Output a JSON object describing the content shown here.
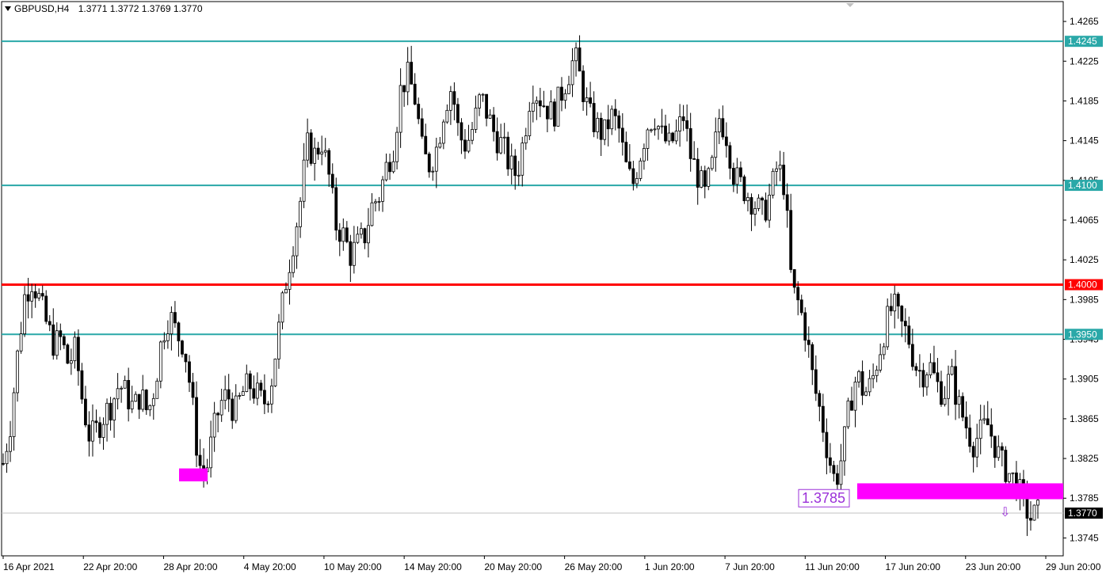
{
  "header": {
    "symbol": "GBPUSD,H4",
    "open": "1.3771",
    "high": "1.3772",
    "low": "1.3769",
    "close": "1.3770"
  },
  "chart_data": {
    "type": "candlestick",
    "instrument": "GBPUSD",
    "timeframe": "H4",
    "ylim": [
      1.3727,
      1.4285
    ],
    "y_ticks": [
      "1.4265",
      "1.4225",
      "1.4185",
      "1.4145",
      "1.4105",
      "1.4065",
      "1.4025",
      "1.3985",
      "1.3945",
      "1.3905",
      "1.3865",
      "1.3825",
      "1.3785",
      "1.3745"
    ],
    "x_ticks": [
      "16 Apr 2021",
      "22 Apr 20:00",
      "28 Apr 20:00",
      "4 May 20:00",
      "10 May 20:00",
      "14 May 20:00",
      "20 May 20:00",
      "26 May 20:00",
      "1 Jun 20:00",
      "7 Jun 20:00",
      "11 Jun 20:00",
      "17 Jun 20:00",
      "23 Jun 20:00",
      "29 Jun 20:00"
    ],
    "levels": [
      {
        "price": 1.4245,
        "label": "1.4245",
        "color": "#2aa8a8"
      },
      {
        "price": 1.41,
        "label": "1.4100",
        "color": "#2aa8a8"
      },
      {
        "price": 1.4,
        "label": "1.4000",
        "color": "#ff0000"
      },
      {
        "price": 1.395,
        "label": "1.3950",
        "color": "#2aa8a8"
      }
    ],
    "current_price": {
      "price": 1.377,
      "label": "1.3770"
    },
    "zones": [
      {
        "label": "",
        "price_top": 1.3815,
        "price_bottom": 1.3802,
        "color": "#ff00ff"
      },
      {
        "label": "1.3785",
        "price_top": 1.38,
        "price_bottom": 1.3784,
        "color": "#ff00ff"
      }
    ],
    "annotation": {
      "text": "1.3785",
      "price": 1.3785,
      "color": "#9b30d9"
    },
    "arrow": {
      "direction": "down",
      "price": 1.377,
      "color": "#9b30d9"
    },
    "path": [
      [
        1.382,
        1
      ],
      [
        1.386,
        1
      ],
      [
        1.393,
        2
      ],
      [
        1.399,
        3
      ],
      [
        1.4005,
        4
      ],
      [
        1.3985,
        5
      ],
      [
        1.396,
        6
      ],
      [
        1.394,
        7
      ],
      [
        1.3945,
        8
      ],
      [
        1.392,
        9
      ],
      [
        1.3935,
        10
      ],
      [
        1.388,
        11
      ],
      [
        1.3845,
        12
      ],
      [
        1.3855,
        13
      ],
      [
        1.387,
        14
      ],
      [
        1.388,
        15
      ],
      [
        1.39,
        16
      ],
      [
        1.389,
        17
      ],
      [
        1.3875,
        18
      ],
      [
        1.389,
        19
      ],
      [
        1.387,
        20
      ],
      [
        1.39,
        21
      ],
      [
        1.395,
        22
      ],
      [
        1.397,
        23
      ],
      [
        1.395,
        24
      ],
      [
        1.394,
        25
      ],
      [
        1.389,
        26
      ],
      [
        1.382,
        27
      ],
      [
        1.381,
        28
      ],
      [
        1.385,
        29
      ],
      [
        1.388,
        30
      ],
      [
        1.389,
        31
      ],
      [
        1.387,
        32
      ],
      [
        1.389,
        33
      ],
      [
        1.39,
        34
      ],
      [
        1.389,
        35
      ],
      [
        1.388,
        36
      ],
      [
        1.39,
        37
      ],
      [
        1.395,
        38
      ],
      [
        1.4,
        39
      ],
      [
        1.404,
        40
      ],
      [
        1.408,
        41
      ],
      [
        1.414,
        42
      ],
      [
        1.413,
        43
      ],
      [
        1.4145,
        44
      ],
      [
        1.411,
        45
      ],
      [
        1.406,
        46
      ],
      [
        1.405,
        47
      ],
      [
        1.403,
        48
      ],
      [
        1.404,
        49
      ],
      [
        1.405,
        50
      ],
      [
        1.408,
        51
      ],
      [
        1.409,
        52
      ],
      [
        1.412,
        53
      ],
      [
        1.414,
        54
      ],
      [
        1.42,
        55
      ],
      [
        1.421,
        56
      ],
      [
        1.4185,
        57
      ],
      [
        1.413,
        58
      ],
      [
        1.412,
        59
      ],
      [
        1.414,
        60
      ],
      [
        1.418,
        61
      ],
      [
        1.42,
        62
      ],
      [
        1.415,
        63
      ],
      [
        1.414,
        64
      ],
      [
        1.416,
        65
      ],
      [
        1.419,
        66
      ],
      [
        1.417,
        67
      ],
      [
        1.415,
        68
      ],
      [
        1.414,
        69
      ],
      [
        1.412,
        70
      ],
      [
        1.411,
        71
      ],
      [
        1.415,
        72
      ],
      [
        1.42,
        73
      ],
      [
        1.419,
        74
      ],
      [
        1.418,
        75
      ],
      [
        1.417,
        76
      ],
      [
        1.419,
        77
      ],
      [
        1.421,
        78
      ],
      [
        1.423,
        79
      ],
      [
        1.42,
        80
      ],
      [
        1.417,
        81
      ],
      [
        1.416,
        82
      ],
      [
        1.415,
        83
      ],
      [
        1.417,
        84
      ],
      [
        1.416,
        85
      ],
      [
        1.412,
        86
      ],
      [
        1.41,
        87
      ],
      [
        1.413,
        88
      ],
      [
        1.416,
        89
      ],
      [
        1.417,
        90
      ],
      [
        1.415,
        91
      ],
      [
        1.414,
        92
      ],
      [
        1.415,
        93
      ],
      [
        1.417,
        94
      ],
      [
        1.413,
        95
      ],
      [
        1.411,
        96
      ],
      [
        1.409,
        97
      ],
      [
        1.412,
        98
      ],
      [
        1.417,
        99
      ],
      [
        1.415,
        100
      ],
      [
        1.411,
        101
      ],
      [
        1.41,
        102
      ],
      [
        1.409,
        103
      ],
      [
        1.408,
        104
      ],
      [
        1.407,
        105
      ],
      [
        1.409,
        106
      ],
      [
        1.412,
        107
      ],
      [
        1.41,
        108
      ],
      [
        1.3995,
        109
      ],
      [
        1.398,
        110
      ],
      [
        1.395,
        111
      ],
      [
        1.39,
        112
      ],
      [
        1.387,
        113
      ],
      [
        1.383,
        114
      ],
      [
        1.38,
        115
      ],
      [
        1.383,
        116
      ],
      [
        1.388,
        117
      ],
      [
        1.391,
        118
      ],
      [
        1.389,
        119
      ],
      [
        1.39,
        120
      ],
      [
        1.393,
        121
      ],
      [
        1.396,
        122
      ],
      [
        1.398,
        123
      ],
      [
        1.396,
        124
      ],
      [
        1.395,
        125
      ],
      [
        1.392,
        126
      ],
      [
        1.391,
        127
      ],
      [
        1.392,
        128
      ],
      [
        1.39,
        129
      ],
      [
        1.389,
        130
      ],
      [
        1.391,
        131
      ],
      [
        1.388,
        132
      ],
      [
        1.386,
        133
      ],
      [
        1.384,
        134
      ],
      [
        1.385,
        135
      ],
      [
        1.386,
        136
      ],
      [
        1.384,
        137
      ],
      [
        1.382,
        138
      ],
      [
        1.381,
        139
      ],
      [
        1.38,
        140
      ],
      [
        1.378,
        141
      ],
      [
        1.3765,
        142
      ],
      [
        1.377,
        143
      ]
    ]
  }
}
